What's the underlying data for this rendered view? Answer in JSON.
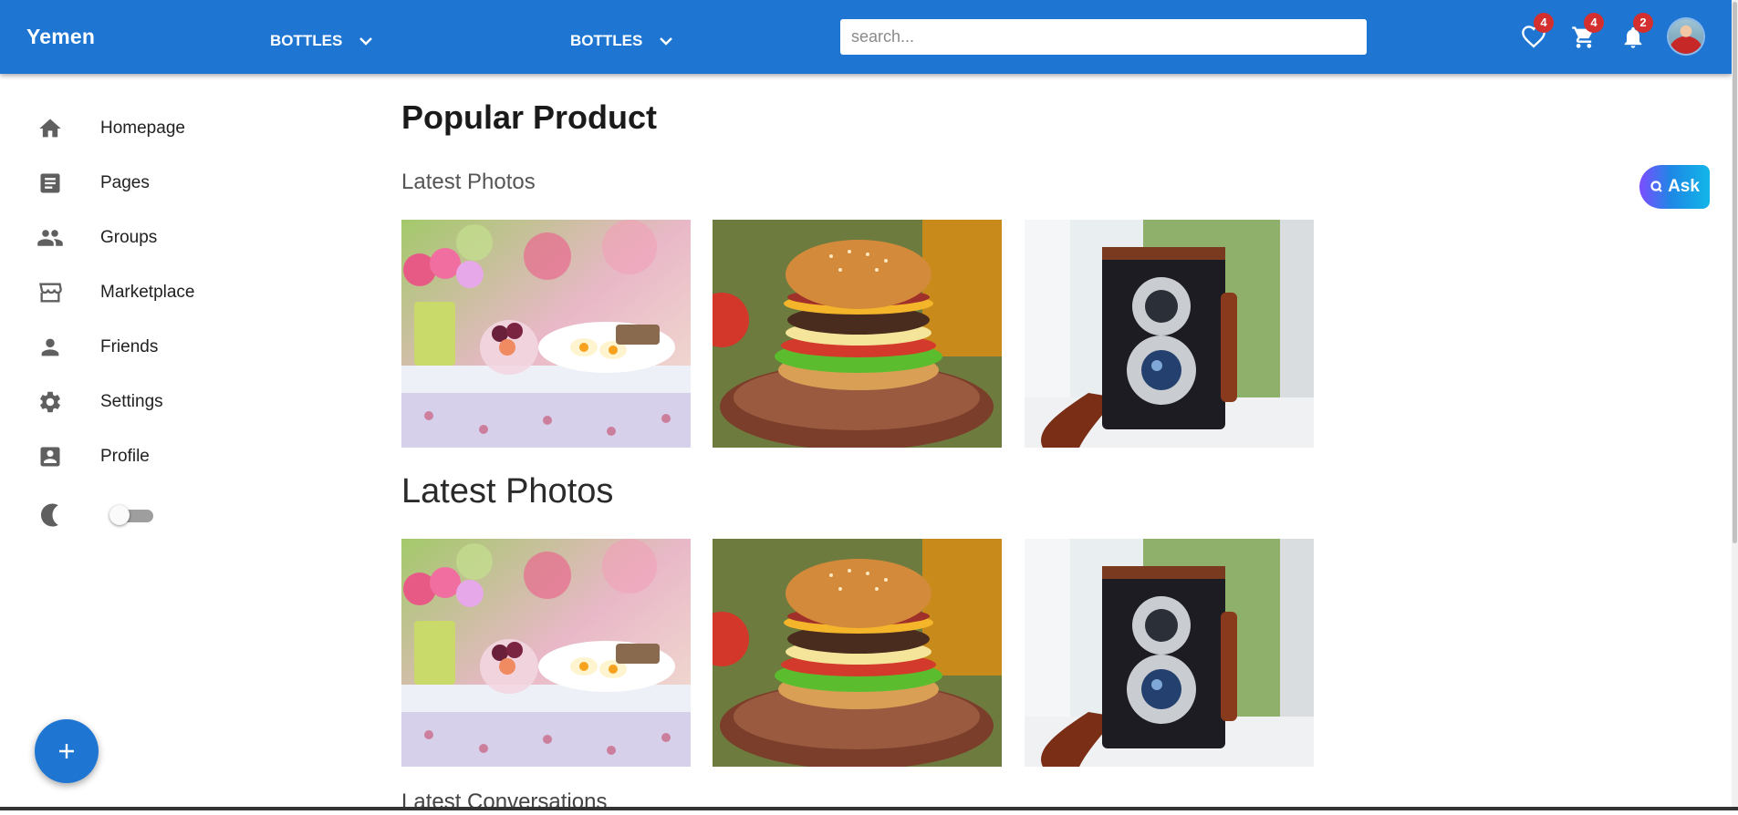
{
  "appbar": {
    "brand": "Yemen",
    "menus": [
      {
        "label": "BOTTLES"
      },
      {
        "label": "BOTTLES"
      }
    ],
    "search": {
      "placeholder": "search...",
      "value": ""
    },
    "actions": {
      "favorites_badge": "4",
      "cart_badge": "4",
      "notifications_badge": "2"
    }
  },
  "sidebar": {
    "items": [
      {
        "label": "Homepage",
        "icon": "home-icon"
      },
      {
        "label": "Pages",
        "icon": "article-icon"
      },
      {
        "label": "Groups",
        "icon": "groups-icon"
      },
      {
        "label": "Marketplace",
        "icon": "store-icon"
      },
      {
        "label": "Friends",
        "icon": "person-icon"
      },
      {
        "label": "Settings",
        "icon": "gear-icon"
      },
      {
        "label": "Profile",
        "icon": "account-box-icon"
      }
    ],
    "theme_toggle": {
      "icon": "moon-icon",
      "on": false
    }
  },
  "main": {
    "title": "Popular Product",
    "section1": "Latest Photos",
    "section2": "Latest Photos",
    "section3": "Latest Conversations",
    "photos": [
      "breakfast-photo",
      "burger-photo",
      "vintage-camera-photo"
    ]
  },
  "ask_button": {
    "label": "Ask"
  },
  "colors": {
    "primary": "#1e76d2",
    "badge": "#d32f2f"
  }
}
